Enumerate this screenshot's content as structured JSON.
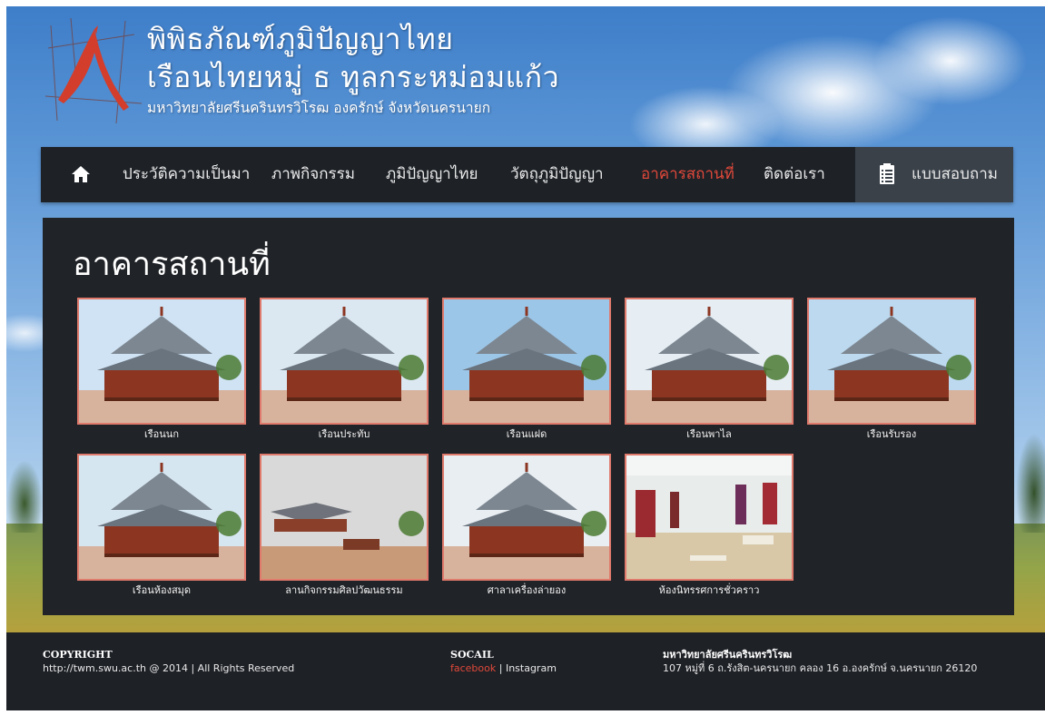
{
  "brand": {
    "line1": "พิพิธภัณฑ์ภูมิปัญญาไทย",
    "line2": "เรือนไทยหมู่ ธ ทูลกระหม่อมแก้ว",
    "line3": "มหาวิทยาลัยศรีนครินทรวิโรฒ องครักษ์ จังหวัดนครนายก"
  },
  "nav": {
    "home_icon": "home-icon",
    "items": [
      {
        "label": "ประวัติความเป็นมา"
      },
      {
        "label": "ภาพกิจกรรม"
      },
      {
        "label": "ภูมิปัญญาไทย"
      },
      {
        "label": "วัตถุภูมิปัญญา"
      },
      {
        "label": "อาคารสถานที่",
        "active": true
      },
      {
        "label": "ติดต่อเรา"
      }
    ],
    "survey": {
      "icon": "clipboard-list-icon",
      "label": "แบบสอบถาม"
    },
    "active_color": "#e0483a"
  },
  "page": {
    "title": "อาคารสถานที่"
  },
  "gallery": [
    {
      "caption": "เรือนนก"
    },
    {
      "caption": "เรือนประทับ"
    },
    {
      "caption": "เรือนแฝด"
    },
    {
      "caption": "เรือนพาไล"
    },
    {
      "caption": "เรือนรับรอง"
    },
    {
      "caption": "เรือนห้องสมุด"
    },
    {
      "caption": "ลานกิจกรรมศิลปวัฒนธรรม"
    },
    {
      "caption": "ศาลาเครื่องล่ายอง"
    },
    {
      "caption": "ห้องนิทรรศการชั่วคราว"
    }
  ],
  "footer": {
    "copyright_heading": "COPYRIGHT",
    "copyright_text": "http://twm.swu.ac.th @ 2014 | All Rights Reserved",
    "social_heading": "SOCAIL",
    "social_facebook": "facebook",
    "social_sep": " | ",
    "social_instagram": "Instagram",
    "address_heading": "มหาวิทยาลัยศรีนครินทรวิโรฒ",
    "address_text": "107 หมู่ที่ 6 ถ.รังสิต-นครนายก คลอง 16 อ.องครักษ์ จ.นครนายก 26120"
  },
  "colors": {
    "panel_bg": "#202327",
    "navbar_bg": "#1e2227",
    "thumb_border": "#e07a6d",
    "footer_bg": "#1e2126"
  }
}
